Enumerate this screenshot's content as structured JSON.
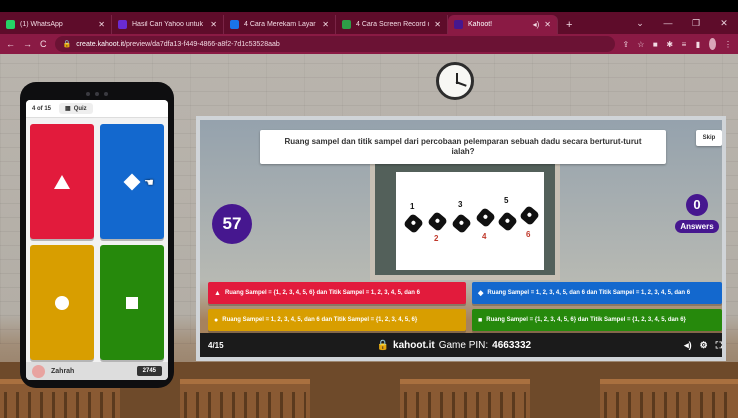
{
  "browser": {
    "tabs": [
      {
        "title": "(1) WhatsApp",
        "favicon_color": "#25d366",
        "active": false
      },
      {
        "title": "Hasil Cari Yahoo untuk cara",
        "favicon_color": "#6a2bd1",
        "active": false
      },
      {
        "title": "4 Cara Merekam Layar Laptop",
        "favicon_color": "#1a73e8",
        "active": false
      },
      {
        "title": "4 Cara Screen Record di Lapt",
        "favicon_color": "#2e9e47",
        "active": false
      },
      {
        "title": "Kahoot!",
        "favicon_color": "#46178f",
        "active": true
      }
    ],
    "new_tab": "+",
    "url_domain": "create.kahoot.it",
    "url_path": "/preview/da7dfa13-f449-4866-a8f2-7d1c53528aab"
  },
  "question": {
    "text": "Ruang sampel dan titik sampel dari percobaan pelemparan sebuah dadu secara berturut-turut ialah?",
    "skip_label": "Skip",
    "timer": "57",
    "answers_count": "0",
    "answers_label": "Answers",
    "dice_numbers": [
      "1",
      "2",
      "3",
      "4",
      "5",
      "6"
    ]
  },
  "answers": [
    {
      "text": "Ruang Sampel = {1, 2, 3, 4, 5, 6} dan Titik Sampel = 1, 2, 3, 4, 5, dan 6",
      "color": "#e21b3c",
      "symbol": "▲"
    },
    {
      "text": "Ruang Sampel = 1, 2, 3, 4, 5, dan 6 dan Titik Sampel = 1, 2, 3, 4, 5, dan 6",
      "color": "#1368ce",
      "symbol": "◆"
    },
    {
      "text": "Ruang Sampel = 1, 2, 3, 4, 5, dan 6 dan Titik Sampel = {1, 2, 3, 4, 5, 6}",
      "color": "#d89e00",
      "symbol": "●"
    },
    {
      "text": "Ruang Sampel = {1, 2, 3, 4, 5, 6} dan Titik Sampel = {1, 2, 3, 4, 5, dan 6}",
      "color": "#26890c",
      "symbol": "■"
    }
  ],
  "footer": {
    "progress": "4/15",
    "brand": "kahoot.it",
    "pin_label": "Game PIN:",
    "pin": "4663332"
  },
  "phone": {
    "progress": "4 of 15",
    "mode": "Quiz",
    "player_name": "Zahrah",
    "score": "2745",
    "tiles": [
      {
        "shape": "triangle",
        "color": "#e21b3c"
      },
      {
        "shape": "diamond",
        "color": "#1368ce"
      },
      {
        "shape": "circle",
        "color": "#d89e00"
      },
      {
        "shape": "square",
        "color": "#26890c"
      }
    ]
  }
}
